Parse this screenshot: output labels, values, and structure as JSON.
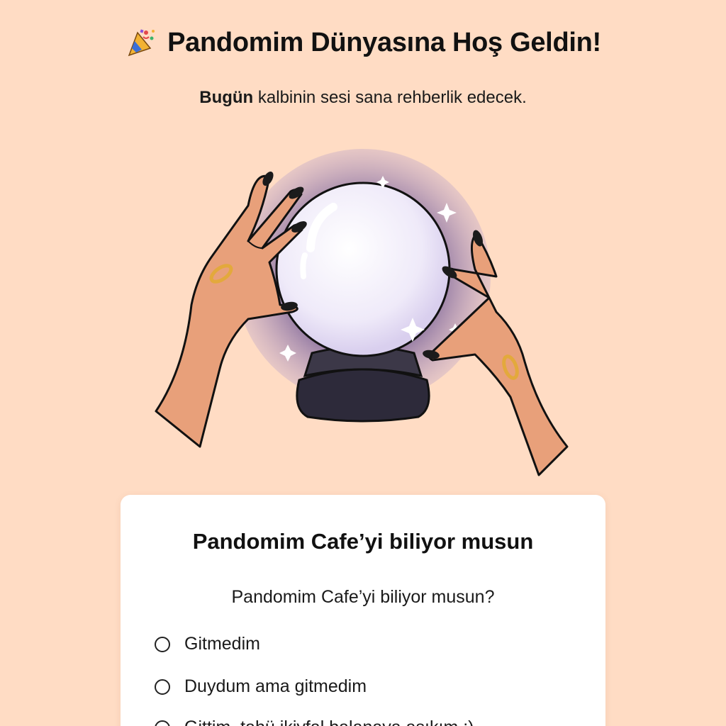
{
  "header": {
    "title": "Pandomim Dünyasına Hoş Geldin!",
    "icon": "party-popper-icon"
  },
  "subtitle": {
    "bold": "Bugün",
    "rest": " kalbinin sesi sana rehberlik edecek."
  },
  "illustration": {
    "name": "crystal-ball-hands",
    "colors": {
      "glow": "#8b6fa8",
      "ball": "#f1ecfb",
      "stand": "#2d2a3a",
      "skin": "#e8a07a",
      "nails": "#1b1b1b",
      "ring": "#e3a93c"
    }
  },
  "question_card": {
    "title": "Pandomim Cafe’yi biliyor musun",
    "question": "Pandomim Cafe’yi biliyor musun?",
    "options": [
      {
        "label": "Gitmedim"
      },
      {
        "label": "Duydum ama gitmedim"
      },
      {
        "label": "Gittim, tahü ikiyfal balanaya aşıkım :)"
      }
    ]
  },
  "colors": {
    "background": "#ffdcc4",
    "card": "#ffffff",
    "text": "#111111"
  }
}
